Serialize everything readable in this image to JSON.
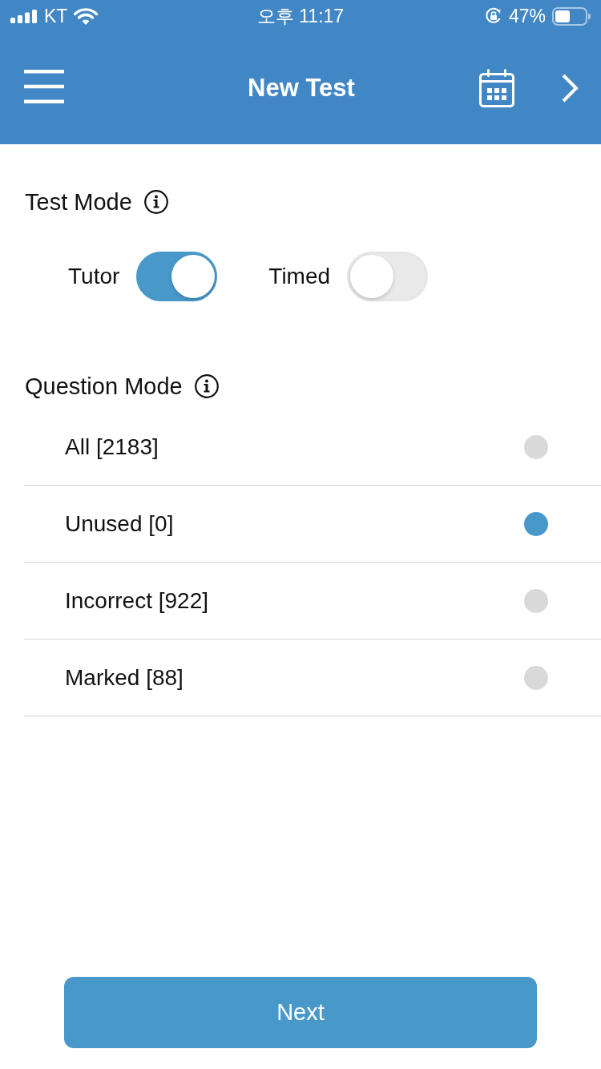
{
  "status_bar": {
    "carrier": "KT",
    "time": "오후 11:17",
    "battery": "47%"
  },
  "header": {
    "title": "New Test"
  },
  "test_mode": {
    "title": "Test Mode",
    "options": [
      {
        "label": "Tutor",
        "on": true
      },
      {
        "label": "Timed",
        "on": false
      }
    ]
  },
  "question_mode": {
    "title": "Question Mode",
    "options": [
      {
        "label": "All [2183]",
        "selected": false
      },
      {
        "label": "Unused [0]",
        "selected": true
      },
      {
        "label": "Incorrect [922]",
        "selected": false
      },
      {
        "label": "Marked [88]",
        "selected": false
      }
    ]
  },
  "next_button": {
    "label": "Next"
  }
}
